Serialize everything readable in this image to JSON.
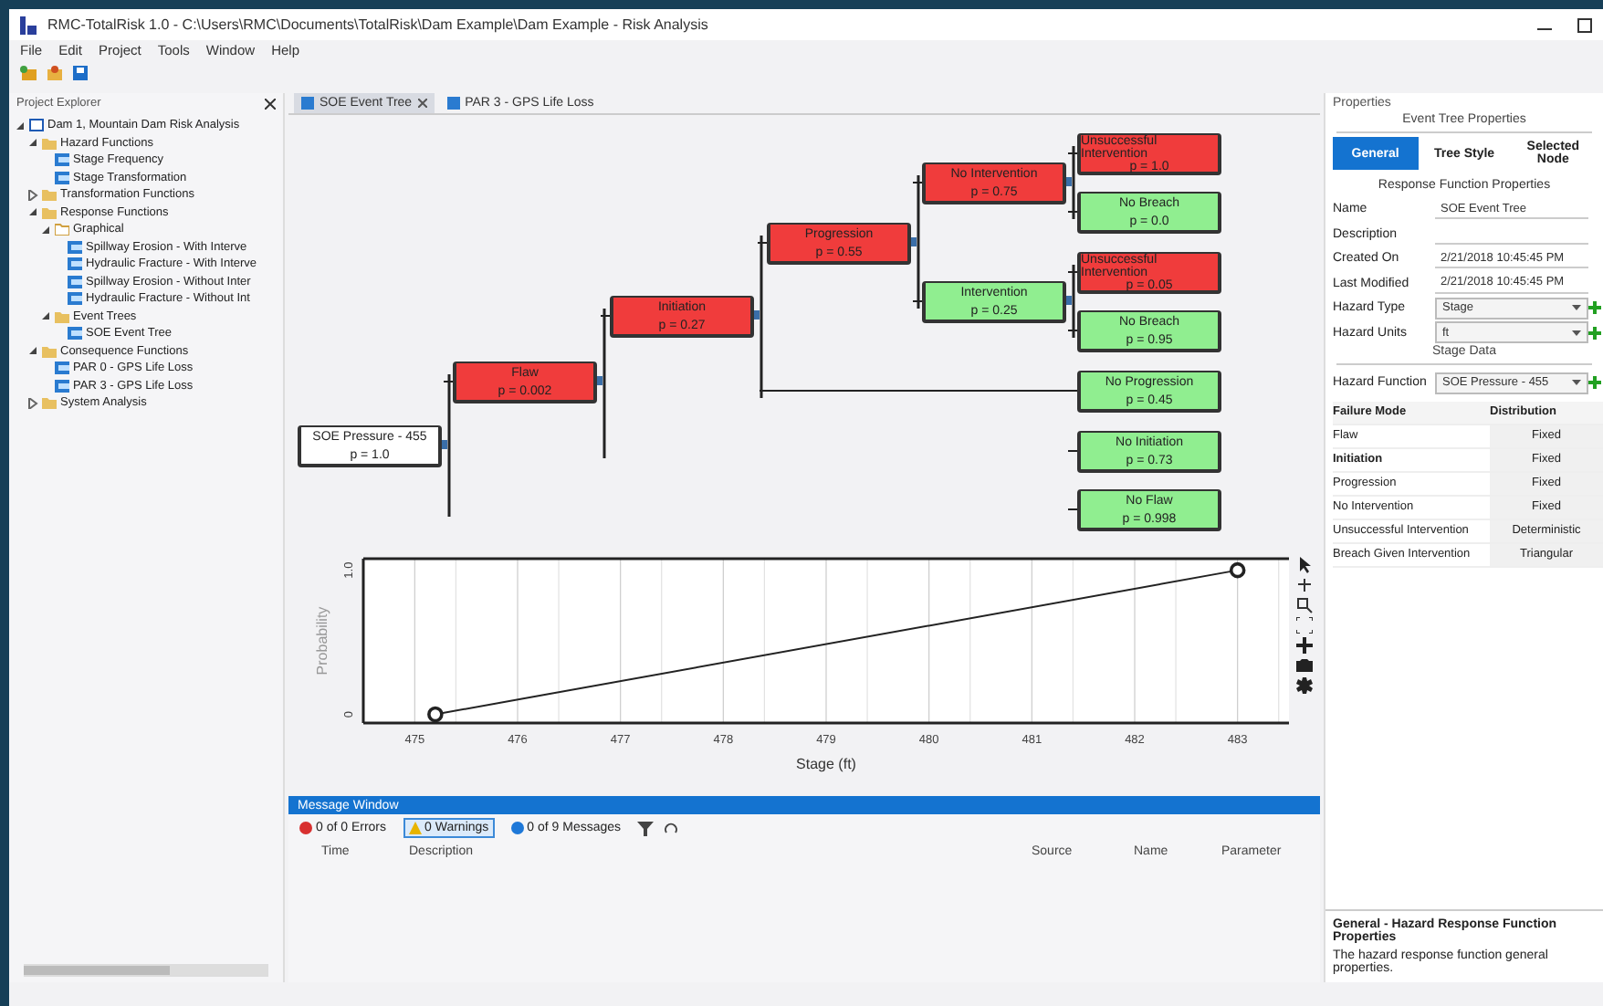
{
  "window": {
    "title": "RMC-TotalRisk 1.0 - C:\\Users\\RMC\\Documents\\TotalRisk\\Dam Example\\Dam Example - Risk Analysis"
  },
  "menu": [
    "File",
    "Edit",
    "Project",
    "Tools",
    "Window",
    "Help"
  ],
  "explorer": {
    "title": "Project Explorer",
    "items": [
      {
        "label": "Dam 1, Mountain Dam Risk Analysis",
        "kind": "project",
        "expanded": true,
        "children": [
          {
            "label": "Hazard Functions",
            "kind": "folder",
            "expanded": true,
            "children": [
              {
                "label": "Stage Frequency",
                "kind": "file"
              },
              {
                "label": "Stage Transformation",
                "kind": "file"
              }
            ]
          },
          {
            "label": "Transformation Functions",
            "kind": "folder",
            "expanded": false
          },
          {
            "label": "Response Functions",
            "kind": "folder",
            "expanded": true,
            "children": [
              {
                "label": "Graphical",
                "kind": "open-folder",
                "expanded": true,
                "children": [
                  {
                    "label": "Spillway Erosion - With Interve",
                    "kind": "file"
                  },
                  {
                    "label": "Hydraulic Fracture - With Interve",
                    "kind": "file"
                  },
                  {
                    "label": "Spillway Erosion - Without Inter",
                    "kind": "file"
                  },
                  {
                    "label": "Hydraulic Fracture - Without Int",
                    "kind": "file"
                  }
                ]
              },
              {
                "label": "Event Trees",
                "kind": "folder",
                "expanded": true,
                "children": [
                  {
                    "label": "SOE Event Tree",
                    "kind": "file"
                  }
                ]
              }
            ]
          },
          {
            "label": "Consequence Functions",
            "kind": "folder",
            "expanded": true,
            "children": [
              {
                "label": "PAR 0 - GPS Life Loss",
                "kind": "file"
              },
              {
                "label": "PAR 3 - GPS Life Loss",
                "kind": "file"
              }
            ]
          },
          {
            "label": "System Analysis",
            "kind": "folder",
            "expanded": false
          }
        ]
      }
    ]
  },
  "tabs": [
    {
      "label": "SOE Event Tree",
      "selected": true
    },
    {
      "label": "PAR 3 - GPS Life Loss",
      "selected": false
    }
  ],
  "event_tree": {
    "label": "SOE Pressure - 455",
    "probability": "p = 1.0",
    "color": "#ffffff",
    "children": [
      {
        "label": "Flaw",
        "probability": "p = 0.002",
        "color": "#f03c3c",
        "children": [
          {
            "label": "Initiation",
            "probability": "p = 0.27",
            "color": "#f03c3c",
            "children": [
              {
                "label": "Progression",
                "probability": "p = 0.55",
                "color": "#f03c3c",
                "children": [
                  {
                    "label": "No Intervention",
                    "probability": "p = 0.75",
                    "color": "#f03c3c",
                    "children": [
                      {
                        "label": "Unsuccessful Intervention",
                        "probability": "p = 1.0",
                        "color": "#f03c3c"
                      },
                      {
                        "label": "No Breach",
                        "probability": "p = 0.0",
                        "color": "#90ee90"
                      }
                    ]
                  },
                  {
                    "label": "Intervention",
                    "probability": "p = 0.25",
                    "color": "#90ee90",
                    "children": [
                      {
                        "label": "Unsuccessful Intervention",
                        "probability": "p = 0.05",
                        "color": "#f03c3c"
                      },
                      {
                        "label": "No Breach",
                        "probability": "p = 0.95",
                        "color": "#90ee90"
                      }
                    ]
                  }
                ]
              },
              {
                "label": "No Progression",
                "probability": "p = 0.45",
                "color": "#90ee90"
              }
            ]
          },
          {
            "label": "No Initiation",
            "probability": "p = 0.73",
            "color": "#90ee90"
          }
        ]
      },
      {
        "label": "No Flaw",
        "probability": "p = 0.998",
        "color": "#90ee90"
      }
    ]
  },
  "chart": {
    "chart_data": {
      "type": "line",
      "xlabel": "Stage (ft)",
      "ylabel": "Probability",
      "x": [
        475.2,
        483
      ],
      "grid": true,
      "series": [
        {
          "color": "#222222",
          "marker": "circle",
          "values": [
            0,
            1
          ]
        }
      ],
      "xlim": [
        474.5,
        483.5
      ],
      "ylim": [
        -0.06,
        1.08
      ],
      "xticks": [
        475,
        476,
        477,
        478,
        479,
        480,
        481,
        482,
        483
      ],
      "yticks": [
        0,
        {
          "value": 1,
          "label": "1.0"
        }
      ]
    }
  },
  "messages": {
    "title": "Message Window",
    "filters": [
      {
        "label": "0 of 0 Errors",
        "kind": "error",
        "selected": false
      },
      {
        "label": "0 Warnings",
        "kind": "warning",
        "selected": true
      },
      {
        "label": "0 of 9 Messages",
        "kind": "info",
        "selected": false
      }
    ],
    "columns": [
      "Time",
      "Description",
      "Source",
      "Name",
      "Parameter"
    ]
  },
  "properties": {
    "title": "Properties",
    "group": "Event Tree Properties",
    "tabs": [
      {
        "label": "General",
        "selected": true
      },
      {
        "label": "Tree Style",
        "selected": false
      },
      {
        "label": "Selected Node",
        "selected": false
      }
    ],
    "section": "Response Function Properties",
    "fields": [
      {
        "label": "Name",
        "value": "SOE Event Tree",
        "kind": "text"
      },
      {
        "label": "Description",
        "kind": "text"
      },
      {
        "label": "Created On",
        "value": "2/21/2018 10:45:45 PM",
        "kind": "readonly"
      },
      {
        "label": "Last Modified",
        "value": "2/21/2018 10:45:45 PM",
        "kind": "readonly"
      },
      {
        "label": "Hazard Type",
        "value": "Stage",
        "kind": "select"
      },
      {
        "label": "Hazard Units",
        "value": "ft",
        "kind": "select"
      }
    ],
    "subgroup": "Stage Data",
    "hazard": {
      "label": "Hazard Function",
      "value": "SOE Pressure - 455"
    },
    "table": {
      "columns": [
        "Failure Mode",
        "Distribution"
      ],
      "rows": [
        {
          "mode": "Flaw",
          "distribution": "Fixed",
          "bold": false
        },
        {
          "mode": "Initiation",
          "distribution": "Fixed",
          "bold": true
        },
        {
          "mode": "Progression",
          "distribution": "Fixed",
          "bold": false
        },
        {
          "mode": "No Intervention",
          "distribution": "Fixed",
          "bold": false
        },
        {
          "mode": "Unsuccessful Intervention",
          "distribution": "Deterministic",
          "bold": false
        },
        {
          "mode": "Breach Given Intervention",
          "distribution": "Triangular",
          "bold": false
        }
      ]
    },
    "help_title": "General - Hazard Response Function Properties",
    "help_text": "The hazard response function general properties."
  }
}
